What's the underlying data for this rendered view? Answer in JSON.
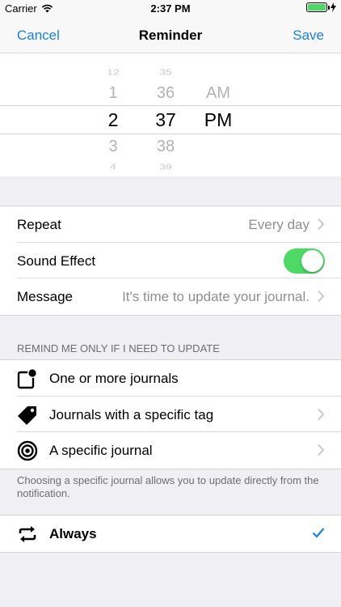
{
  "status_bar": {
    "carrier": "Carrier",
    "time": "2:37 PM",
    "battery_level": 1.0
  },
  "nav": {
    "cancel_label": "Cancel",
    "title": "Reminder",
    "save_label": "Save"
  },
  "time_picker": {
    "hours": [
      "12",
      "1",
      "2",
      "3",
      "4"
    ],
    "minutes": [
      "35",
      "36",
      "37",
      "38",
      "39"
    ],
    "periods": [
      "AM",
      "PM"
    ],
    "selected": {
      "hour": "2",
      "minute": "37",
      "period": "PM"
    }
  },
  "settings": {
    "repeat": {
      "label": "Repeat",
      "value": "Every day"
    },
    "sound_effect": {
      "label": "Sound Effect",
      "enabled": true
    },
    "message": {
      "label": "Message",
      "value": "It's time to update your journal."
    }
  },
  "remind_section": {
    "header": "REMIND ME ONLY IF I NEED TO UPDATE",
    "items": [
      {
        "label": "One or more journals",
        "icon": "journal-badge-icon"
      },
      {
        "label": "Journals with a specific tag",
        "icon": "tag-icon"
      },
      {
        "label": "A specific journal",
        "icon": "target-icon"
      }
    ],
    "footnote": "Choosing a specific journal allows you to update directly from the notification."
  },
  "frequency": {
    "label": "Always",
    "icon": "repeat-icon",
    "selected": true
  },
  "colors": {
    "accent": "#1a80e6",
    "toggle_on": "#4cd964",
    "secondary_text": "#8e8e93",
    "background": "#efeff4"
  }
}
